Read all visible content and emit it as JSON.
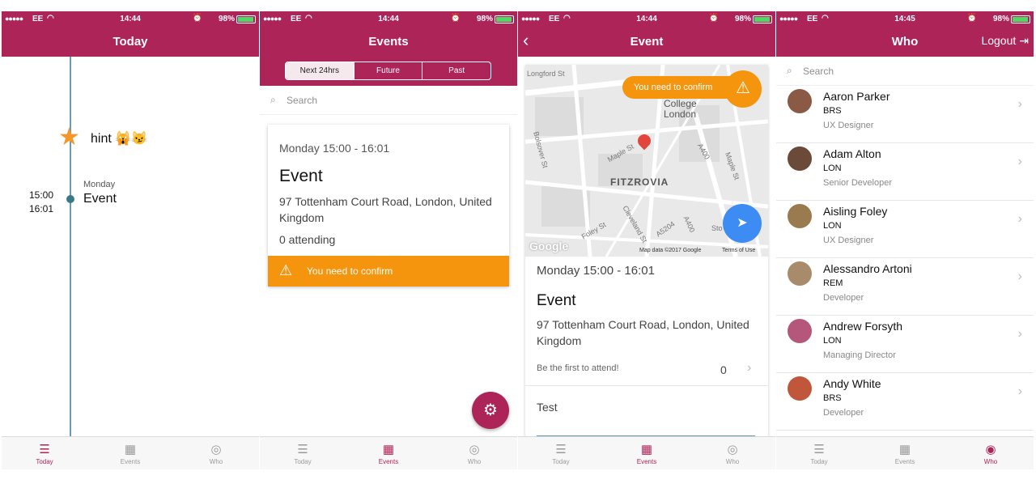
{
  "status": {
    "signal": "●●●●●",
    "carrier": "EE",
    "battery": "98%",
    "times": [
      "14:44",
      "14:44",
      "14:44",
      "14:45"
    ]
  },
  "colors": {
    "brand": "#ad2459",
    "warning": "#f5950e",
    "accent": "#3d8cf4",
    "timeline": "#6a9bb5"
  },
  "tabbar": {
    "today": "Today",
    "events": "Events",
    "who": "Who"
  },
  "today": {
    "title": "Today",
    "hint": "hint 🙀😼",
    "start_time": "15:00",
    "end_time": "16:01",
    "day": "Monday",
    "event": "Event"
  },
  "events": {
    "title": "Events",
    "segments": [
      "Next 24hrs",
      "Future",
      "Past"
    ],
    "selected_segment": "Next 24hrs",
    "search_placeholder": "Search",
    "card": {
      "when": "Monday 15:00 - 16:01",
      "title": "Event",
      "address": "97 Tottenham Court Road, London, United Kingdom",
      "attending": "0 attending",
      "confirm": "You need to confirm"
    }
  },
  "event_detail": {
    "title": "Event",
    "map": {
      "confirm": "You need to confirm",
      "labels": [
        "Longford St",
        "College London",
        "Bolsover St",
        "Maple St",
        "FITZROVIA",
        "A400",
        "Maple St",
        "Cleveland St",
        "Foley St",
        "A5204",
        "A400",
        "Sto"
      ],
      "google": "Google",
      "map_data": "Map data ©2017 Google",
      "terms": "Terms of Use"
    },
    "when": "Monday 15:00 - 16:01",
    "event_title": "Event",
    "address": "97 Tottenham Court Road, London, United Kingdom",
    "first_to_attend": "Be the first to attend!",
    "attend_count": "0",
    "description": "Test"
  },
  "who": {
    "title": "Who",
    "logout": "Logout",
    "search_placeholder": "Search",
    "people": [
      {
        "name": "Aaron Parker",
        "office": "BRS",
        "role": "UX Designer"
      },
      {
        "name": "Adam Alton",
        "office": "LON",
        "role": "Senior Developer"
      },
      {
        "name": "Aisling Foley",
        "office": "LON",
        "role": "UX Designer"
      },
      {
        "name": "Alessandro Artoni",
        "office": "REM",
        "role": "Developer"
      },
      {
        "name": "Andrew Forsyth",
        "office": "LON",
        "role": "Managing Director"
      },
      {
        "name": "Andy White",
        "office": "BRS",
        "role": "Developer"
      }
    ]
  }
}
